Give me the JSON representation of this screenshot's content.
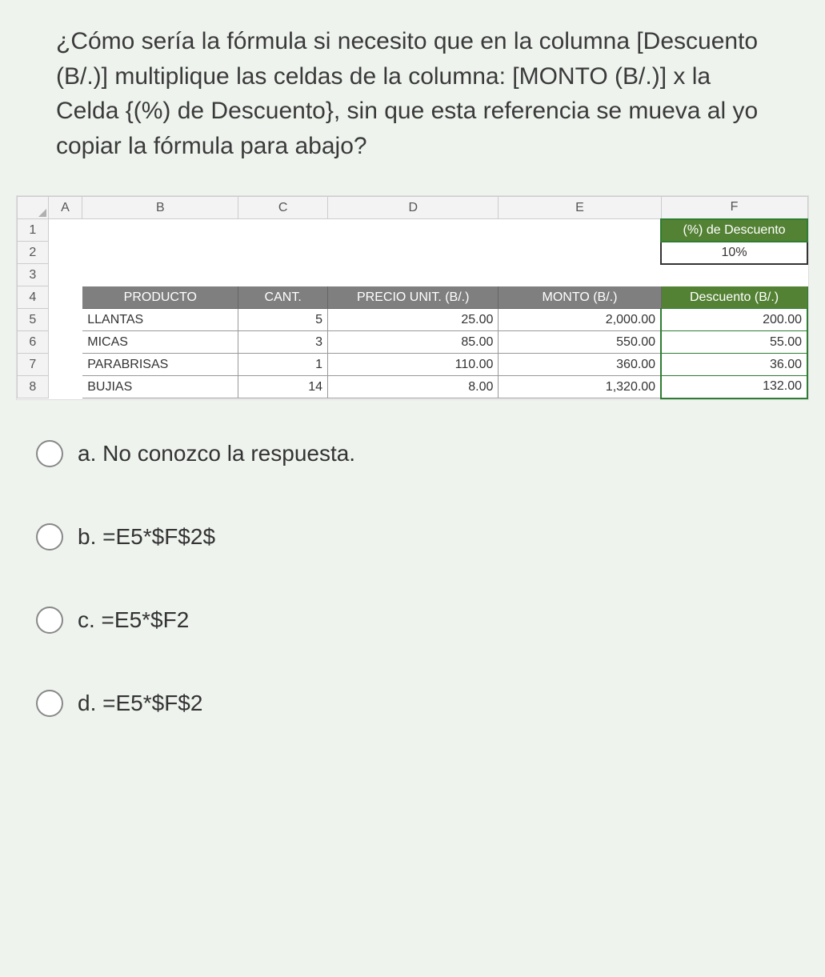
{
  "question": "¿Cómo sería la fórmula si necesito que en la columna [Descuento (B/.)] multiplique las celdas de la columna: [MONTO (B/.)] x la Celda {(%) de Descuento}, sin que esta referencia se mueva al yo copiar la fórmula para abajo?",
  "sheet": {
    "columns": [
      "A",
      "B",
      "C",
      "D",
      "E",
      "F"
    ],
    "row_numbers": [
      "1",
      "2",
      "3",
      "4",
      "5",
      "6",
      "7",
      "8"
    ],
    "f1_label": "(%) de Descuento",
    "f2_value": "10%",
    "headers": {
      "producto": "PRODUCTO",
      "cant": "CANT.",
      "precio": "PRECIO UNIT. (B/.)",
      "monto": "MONTO (B/.)",
      "descuento": "Descuento (B/.)"
    },
    "rows": [
      {
        "producto": "LLANTAS",
        "cant": "5",
        "precio": "25.00",
        "monto": "2,000.00",
        "desc": "200.00"
      },
      {
        "producto": "MICAS",
        "cant": "3",
        "precio": "85.00",
        "monto": "550.00",
        "desc": "55.00"
      },
      {
        "producto": "PARABRISAS",
        "cant": "1",
        "precio": "110.00",
        "monto": "360.00",
        "desc": "36.00"
      },
      {
        "producto": "BUJIAS",
        "cant": "14",
        "precio": "8.00",
        "monto": "1,320.00",
        "desc": "132.00"
      }
    ]
  },
  "options": {
    "a": "a. No conozco la respuesta.",
    "b": "b. =E5*$F$2$",
    "c": "c. =E5*$F2",
    "d": "d. =E5*$F$2"
  }
}
